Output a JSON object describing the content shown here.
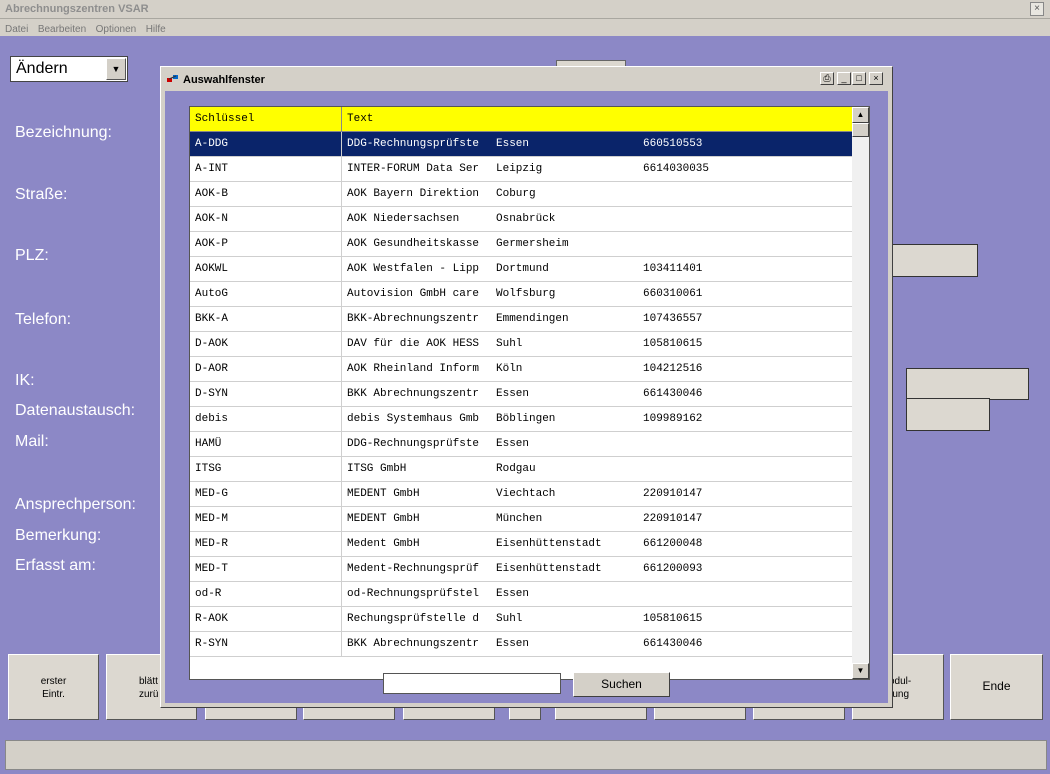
{
  "app": {
    "title": "Abrechnungszentren VSAR",
    "close": "×"
  },
  "menu": [
    "Datei",
    "Bearbeiten",
    "Optionen",
    "Hilfe"
  ],
  "mode_select": {
    "value": "Ändern",
    "arrow": "▼"
  },
  "labels": {
    "bezeichnung": "Bezeichnung:",
    "strasse": "Straße:",
    "plz": "PLZ:",
    "telefon": "Telefon:",
    "ik": "IK:",
    "datenaustausch": "Datenaustausch:",
    "mail": "Mail:",
    "ansprechperson": "Ansprechperson:",
    "bemerkung": "Bemerkung:",
    "erfasst_am": "Erfasst am:"
  },
  "bottom_buttons": {
    "erster": "erster\nEintr.",
    "blaettern_partial": "blätt\nzurü",
    "modul_partial": "odul-\nrung",
    "ende": "Ende"
  },
  "dialog": {
    "title": "Auswahlfenster",
    "window_buttons": {
      "print": "⎙",
      "minimize": "_",
      "maximize": "□",
      "close": "×"
    },
    "columns": [
      "Schlüssel",
      "Text"
    ],
    "rows": [
      [
        "A-DDG",
        "DDG-Rechnungsprüfste",
        "Essen",
        "660510553"
      ],
      [
        "A-INT",
        "INTER-FORUM Data Ser",
        "Leipzig",
        "6614030035"
      ],
      [
        "AOK-B",
        "AOK Bayern Direktion",
        "Coburg",
        ""
      ],
      [
        "AOK-N",
        "AOK Niedersachsen",
        "Osnabrück",
        ""
      ],
      [
        "AOK-P",
        "AOK Gesundheitskasse",
        "Germersheim",
        ""
      ],
      [
        "AOKWL",
        "AOK Westfalen - Lipp",
        "Dortmund",
        "103411401"
      ],
      [
        "AutoG",
        "Autovision GmbH care",
        "Wolfsburg",
        "660310061"
      ],
      [
        "BKK-A",
        "BKK-Abrechnungszentr",
        "Emmendingen",
        "107436557"
      ],
      [
        "D-AOK",
        "DAV für die AOK HESS",
        "Suhl",
        "105810615"
      ],
      [
        "D-AOR",
        "AOK Rheinland Inform",
        "Köln",
        "104212516"
      ],
      [
        "D-SYN",
        "BKK Abrechnungszentr",
        "Essen",
        "661430046"
      ],
      [
        "debis",
        "debis Systemhaus Gmb",
        "Böblingen",
        "109989162"
      ],
      [
        "HAMÜ",
        "DDG-Rechnungsprüfste",
        "Essen",
        ""
      ],
      [
        "ITSG",
        "ITSG GmbH",
        "Rodgau",
        ""
      ],
      [
        "MED-G",
        "MEDENT GmbH",
        "Viechtach",
        "220910147"
      ],
      [
        "MED-M",
        "MEDENT GmbH",
        "München",
        "220910147"
      ],
      [
        "MED-R",
        "Medent GmbH",
        "Eisenhüttenstadt",
        "661200048"
      ],
      [
        "MED-T",
        "Medent-Rechnungsprüf",
        "Eisenhüttenstadt",
        "661200093"
      ],
      [
        "od-R",
        "od-Rechnungsprüfstel",
        "Essen",
        ""
      ],
      [
        "R-AOK",
        "Rechungsprüfstelle d",
        "Suhl",
        "105810615"
      ],
      [
        "R-SYN",
        "BKK Abrechnungszentr",
        "Essen",
        "661430046"
      ]
    ],
    "selected_row": 0,
    "search": {
      "value": "",
      "button": "Suchen"
    },
    "scroll": {
      "up": "▲",
      "down": "▼"
    }
  },
  "colors": {
    "background": "#8c88c6",
    "header": "#ffff00",
    "selection": "#0a246a"
  }
}
